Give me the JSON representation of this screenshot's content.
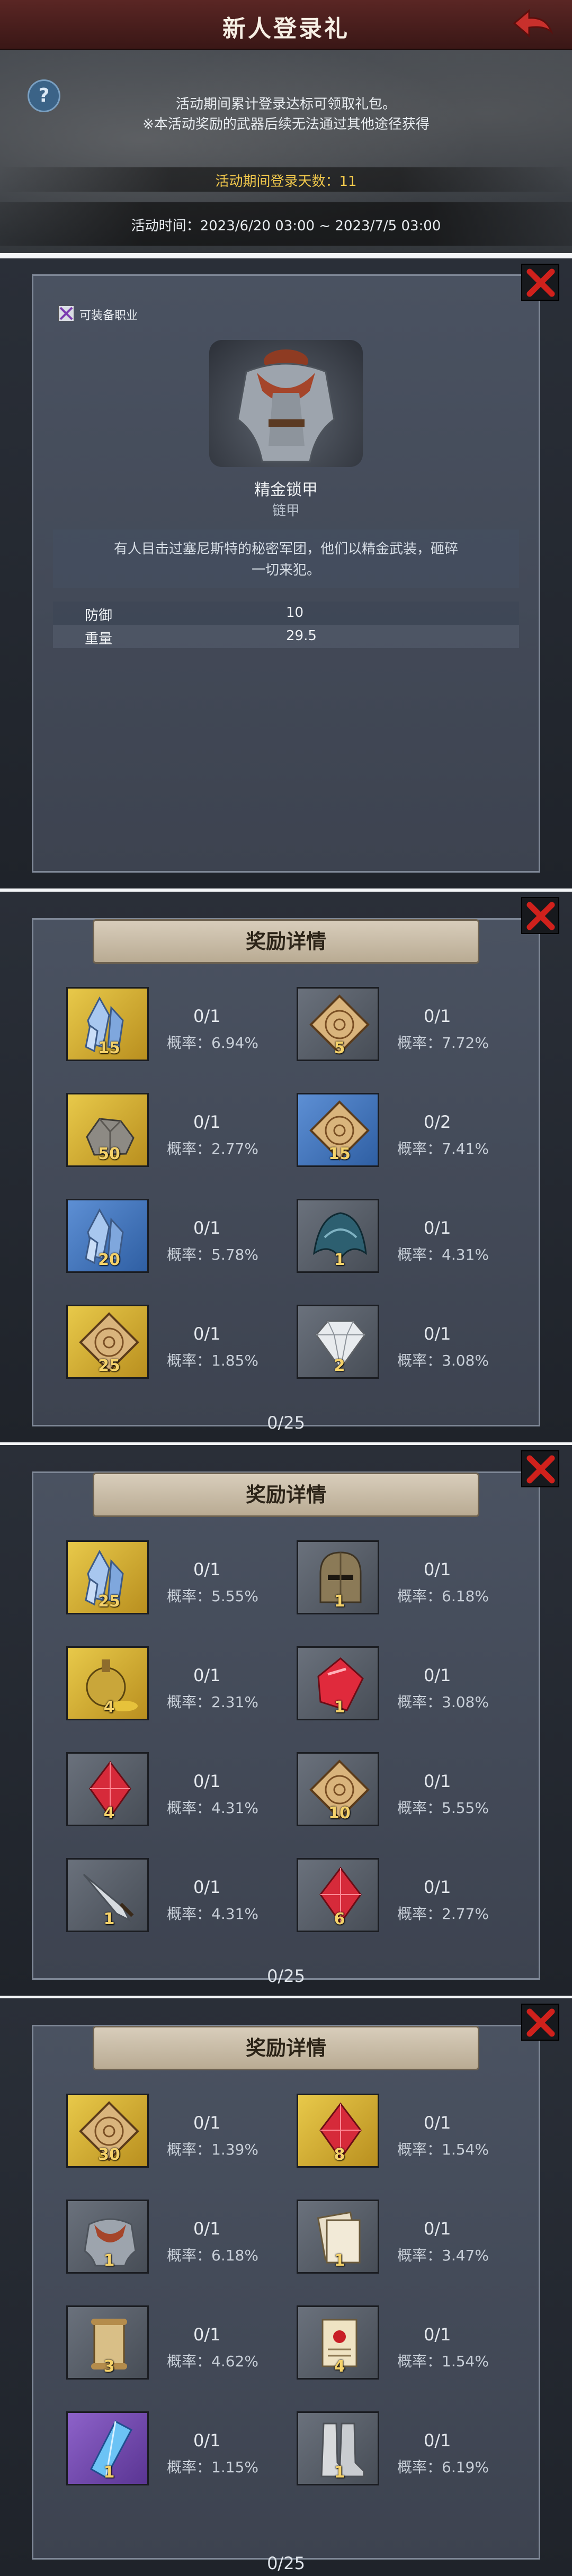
{
  "header": {
    "title": "新人登录礼",
    "desc_line1": "活动期间累计登录达标可领取礼包。",
    "desc_line2": "※本活动奖励的武器后续无法通过其他途径获得",
    "login_days": "活动期间登录天数：11",
    "activity_time": "活动时间：2023/6/20 03:00 ~ 2023/7/5 03:00"
  },
  "item_detail": {
    "class_label": "可装备职业",
    "name": "精金锁甲",
    "type": "链甲",
    "desc_line1": "有人目击过塞尼斯特的秘密军团，他们以精金武装，砸碎",
    "desc_line2": "一切来犯。",
    "stats": [
      {
        "label": "防御",
        "value": "10"
      },
      {
        "label": "重量",
        "value": "29.5"
      }
    ]
  },
  "reward_panels": [
    {
      "title": "奖励详情",
      "total": "0/25",
      "items": [
        {
          "icon": "crystal-icon",
          "bg": "yellow",
          "qty": "15",
          "count": "0/1",
          "prob": "概率：6.94%"
        },
        {
          "icon": "map-icon",
          "bg": "grey",
          "qty": "5",
          "count": "0/1",
          "prob": "概率：7.72%"
        },
        {
          "icon": "stone-icon",
          "bg": "yellow",
          "qty": "50",
          "count": "0/1",
          "prob": "概率：2.77%"
        },
        {
          "icon": "map-icon",
          "bg": "blue",
          "qty": "15",
          "count": "0/2",
          "prob": "概率：7.41%"
        },
        {
          "icon": "crystal-icon",
          "bg": "blue",
          "qty": "20",
          "count": "0/1",
          "prob": "概率：5.78%"
        },
        {
          "icon": "fur-icon",
          "bg": "grey",
          "qty": "1",
          "count": "0/1",
          "prob": "概率：4.31%"
        },
        {
          "icon": "map-icon",
          "bg": "yellow",
          "qty": "25",
          "count": "0/1",
          "prob": "概率：1.85%"
        },
        {
          "icon": "diamond-icon",
          "bg": "grey",
          "qty": "2",
          "count": "0/1",
          "prob": "概率：3.08%"
        }
      ]
    },
    {
      "title": "奖励详情",
      "total": "0/25",
      "items": [
        {
          "icon": "crystal-icon",
          "bg": "yellow",
          "qty": "25",
          "count": "0/1",
          "prob": "概率：5.55%"
        },
        {
          "icon": "helmet-icon",
          "bg": "grey",
          "qty": "1",
          "count": "0/1",
          "prob": "概率：6.18%"
        },
        {
          "icon": "potion-icon",
          "bg": "yellow",
          "qty": "4",
          "count": "0/1",
          "prob": "概率：2.31%"
        },
        {
          "icon": "ruby-icon",
          "bg": "grey",
          "qty": "1",
          "count": "0/1",
          "prob": "概率：3.08%"
        },
        {
          "icon": "red-gem-icon",
          "bg": "grey",
          "qty": "4",
          "count": "0/1",
          "prob": "概率：4.31%"
        },
        {
          "icon": "map-icon",
          "bg": "grey",
          "qty": "10",
          "count": "0/1",
          "prob": "概率：5.55%"
        },
        {
          "icon": "weapon-icon",
          "bg": "grey",
          "qty": "1",
          "count": "0/1",
          "prob": "概率：4.31%"
        },
        {
          "icon": "red-gem-icon",
          "bg": "grey",
          "qty": "6",
          "count": "0/1",
          "prob": "概率：2.77%"
        }
      ]
    },
    {
      "title": "奖励详情",
      "total": "0/25",
      "items": [
        {
          "icon": "map-icon",
          "bg": "yellow",
          "qty": "30",
          "count": "0/1",
          "prob": "概率：1.39%"
        },
        {
          "icon": "red-gem-icon",
          "bg": "yellow",
          "qty": "8",
          "count": "0/1",
          "prob": "概率：1.54%"
        },
        {
          "icon": "armor-icon",
          "bg": "grey",
          "qty": "1",
          "count": "0/1",
          "prob": "概率：6.18%"
        },
        {
          "icon": "paper-icon",
          "bg": "grey",
          "qty": "1",
          "count": "0/1",
          "prob": "概率：3.47%"
        },
        {
          "icon": "scroll-icon",
          "bg": "grey",
          "qty": "3",
          "count": "0/1",
          "prob": "概率：4.62%"
        },
        {
          "icon": "sealed-scroll-icon",
          "bg": "grey",
          "qty": "4",
          "count": "0/1",
          "prob": "概率：1.54%"
        },
        {
          "icon": "blue-crystal-icon",
          "bg": "purple",
          "qty": "1",
          "count": "0/1",
          "prob": "概率：1.15%"
        },
        {
          "icon": "boots-icon",
          "bg": "grey",
          "qty": "1",
          "count": "0/1",
          "prob": "概率：6.19%"
        }
      ]
    }
  ]
}
